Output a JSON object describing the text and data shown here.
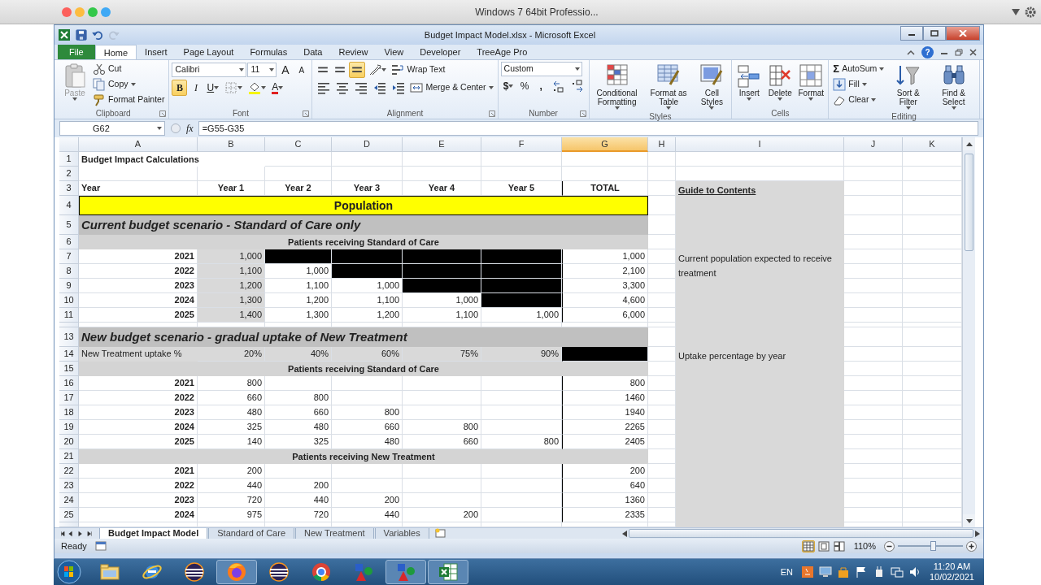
{
  "host": {
    "title": "Windows 7 64bit Professio..."
  },
  "excel": {
    "title": "Budget Impact Model.xlsx - Microsoft Excel",
    "quick_access": [
      {
        "kind": "save",
        "disabled": false
      },
      {
        "kind": "undo",
        "disabled": false
      },
      {
        "kind": "redo",
        "disabled": true
      }
    ],
    "tabs": [
      {
        "label": "File",
        "kind": "file",
        "selected": false
      },
      {
        "label": "Home",
        "kind": "tab",
        "selected": true
      },
      {
        "label": "Insert",
        "kind": "tab",
        "selected": false
      },
      {
        "label": "Page Layout",
        "kind": "tab",
        "selected": false
      },
      {
        "label": "Formulas",
        "kind": "tab",
        "selected": false
      },
      {
        "label": "Data",
        "kind": "tab",
        "selected": false
      },
      {
        "label": "Review",
        "kind": "tab",
        "selected": false
      },
      {
        "label": "View",
        "kind": "tab",
        "selected": false
      },
      {
        "label": "Developer",
        "kind": "tab",
        "selected": false
      },
      {
        "label": "TreeAge Pro",
        "kind": "tab",
        "selected": false
      }
    ],
    "help": "?",
    "groups": [
      {
        "label": "Clipboard",
        "launcher": true,
        "blocks": [
          {
            "kind": "large",
            "label": "Paste",
            "dropdown": true,
            "disabled": true
          },
          {
            "kind": "stack",
            "lines": [
              [
                {
                  "kind": "small",
                  "label": "Cut",
                  "dropdown": false
                }
              ],
              [
                {
                  "kind": "small",
                  "label": "Copy",
                  "dropdown": true
                }
              ],
              [
                {
                  "kind": "small",
                  "label": "Format Painter",
                  "dropdown": false
                }
              ]
            ]
          }
        ]
      },
      {
        "label": "Font",
        "launcher": true,
        "blocks": [
          {
            "kind": "stack",
            "lines": [
              [
                {
                  "kind": "combo",
                  "value": "Calibri"
                },
                {
                  "kind": "combo",
                  "value": "11"
                },
                {
                  "kind": "icon",
                  "text": "A",
                  "selected": false,
                  "dropdown": false
                },
                {
                  "kind": "icon",
                  "text": "A",
                  "selected": false,
                  "dropdown": false
                }
              ],
              [
                {
                  "kind": "icon",
                  "text": "B",
                  "selected": true,
                  "dropdown": false
                },
                {
                  "kind": "icon",
                  "text": "I",
                  "selected": false,
                  "dropdown": false
                },
                {
                  "kind": "icon",
                  "text": "U",
                  "selected": false,
                  "dropdown": true
                },
                {
                  "kind": "icon",
                  "selected": false,
                  "dropdown": true
                },
                {
                  "kind": "icon",
                  "selected": false,
                  "dropdown": true
                },
                {
                  "kind": "icon",
                  "text": "A",
                  "selected": false,
                  "dropdown": true
                }
              ]
            ]
          }
        ]
      },
      {
        "label": "Alignment",
        "launcher": true,
        "blocks": [
          {
            "kind": "stack",
            "lines": [
              [
                {
                  "kind": "icon",
                  "selected": false,
                  "dropdown": false
                },
                {
                  "kind": "icon",
                  "selected": false,
                  "dropdown": false
                },
                {
                  "kind": "icon",
                  "selected": true,
                  "dropdown": false
                },
                {
                  "kind": "icon",
                  "selected": false,
                  "dropdown": true
                },
                {
                  "kind": "small",
                  "label": "Wrap Text",
                  "dropdown": false
                }
              ],
              [
                {
                  "kind": "icon",
                  "selected": false,
                  "dropdown": false
                },
                {
                  "kind": "icon",
                  "selected": false,
                  "dropdown": false
                },
                {
                  "kind": "icon",
                  "selected": false,
                  "dropdown": false
                },
                {
                  "kind": "icon",
                  "selected": false,
                  "dropdown": false
                },
                {
                  "kind": "icon",
                  "selected": false,
                  "dropdown": false
                },
                {
                  "kind": "small",
                  "label": "Merge & Center",
                  "dropdown": true
                }
              ]
            ]
          }
        ]
      },
      {
        "label": "Number",
        "launcher": true,
        "blocks": [
          {
            "kind": "stack",
            "lines": [
              [
                {
                  "kind": "combo",
                  "value": "Custom"
                }
              ],
              [
                {
                  "kind": "icon",
                  "text": "$",
                  "selected": false,
                  "dropdown": true
                },
                {
                  "kind": "icon",
                  "text": "%",
                  "selected": false,
                  "dropdown": false
                },
                {
                  "kind": "icon",
                  "text": ",",
                  "selected": false,
                  "dropdown": false
                },
                {
                  "kind": "icon",
                  "selected": false,
                  "dropdown": false
                },
                {
                  "kind": "icon",
                  "selected": false,
                  "dropdown": false
                }
              ]
            ]
          }
        ]
      },
      {
        "label": "Styles",
        "launcher": false,
        "blocks": [
          {
            "kind": "large",
            "label": "Conditional Formatting",
            "dropdown": true,
            "disabled": false
          },
          {
            "kind": "large",
            "label": "Format as Table",
            "dropdown": true,
            "disabled": false
          },
          {
            "kind": "large",
            "label": "Cell Styles",
            "dropdown": true,
            "disabled": false
          }
        ]
      },
      {
        "label": "Cells",
        "launcher": false,
        "blocks": [
          {
            "kind": "large",
            "label": "Insert",
            "dropdown": true,
            "disabled": false
          },
          {
            "kind": "large",
            "label": "Delete",
            "dropdown": true,
            "disabled": false
          },
          {
            "kind": "large",
            "label": "Format",
            "dropdown": true,
            "disabled": false
          }
        ]
      },
      {
        "label": "Editing",
        "launcher": false,
        "blocks": [
          {
            "kind": "stack",
            "lines": [
              [
                {
                  "kind": "small",
                  "symbol": "Σ",
                  "label": "AutoSum",
                  "dropdown": true
                }
              ],
              [
                {
                  "kind": "small",
                  "label": "Fill",
                  "dropdown": true
                }
              ],
              [
                {
                  "kind": "small",
                  "label": "Clear",
                  "dropdown": true
                }
              ]
            ]
          },
          {
            "kind": "large",
            "label": "Sort & Filter",
            "dropdown": true,
            "disabled": false
          },
          {
            "kind": "large",
            "label": "Find & Select",
            "dropdown": true,
            "disabled": false
          }
        ]
      }
    ],
    "name_box": "G62",
    "function_label": "fx",
    "formula": "=G55-G35"
  },
  "sheet": {
    "columns": [
      {
        "label": "A",
        "selected": false
      },
      {
        "label": "B",
        "selected": false
      },
      {
        "label": "C",
        "selected": false
      },
      {
        "label": "D",
        "selected": false
      },
      {
        "label": "E",
        "selected": false
      },
      {
        "label": "F",
        "selected": false
      },
      {
        "label": "G",
        "selected": true
      },
      {
        "label": "H",
        "selected": false
      },
      {
        "label": "I",
        "selected": false
      },
      {
        "label": "J",
        "selected": false
      },
      {
        "label": "K",
        "selected": false
      }
    ],
    "rows": [
      {
        "n": "1",
        "kind": "title",
        "label": "Budget Impact Calculations"
      },
      {
        "n": "2",
        "kind": "blank"
      },
      {
        "n": "3",
        "kind": "header",
        "label": "Year",
        "values": [
          {
            "text": "Year 1"
          },
          {
            "text": "Year 2"
          },
          {
            "text": "Year 3"
          },
          {
            "text": "Year 4"
          },
          {
            "text": "Year 5"
          }
        ],
        "total": {
          "text": "TOTAL"
        },
        "note": "Guide to Contents"
      },
      {
        "n": "4",
        "kind": "population",
        "label": "Population"
      },
      {
        "n": "5",
        "kind": "scenario",
        "label": "Current budget scenario - Standard of Care only"
      },
      {
        "n": "6",
        "kind": "section",
        "label": "Patients receiving Standard of Care"
      },
      {
        "n": "7",
        "kind": "data",
        "label": "2021",
        "values": [
          {
            "text": "1,000",
            "color": "#d9d9d9"
          },
          {
            "color": "#000000"
          },
          {
            "color": "#000000"
          },
          {
            "color": "#000000"
          },
          {
            "color": "#000000"
          }
        ],
        "total": {
          "text": "1,000"
        },
        "note": "Current population expected to receive treatment"
      },
      {
        "n": "8",
        "kind": "data",
        "label": "2022",
        "values": [
          {
            "text": "1,100",
            "color": "#d9d9d9"
          },
          {
            "text": "1,000"
          },
          {
            "color": "#000000"
          },
          {
            "color": "#000000"
          },
          {
            "color": "#000000"
          }
        ],
        "total": {
          "text": "2,100"
        }
      },
      {
        "n": "9",
        "kind": "data",
        "label": "2023",
        "values": [
          {
            "text": "1,200",
            "color": "#d9d9d9"
          },
          {
            "text": "1,100"
          },
          {
            "text": "1,000"
          },
          {
            "color": "#000000"
          },
          {
            "color": "#000000"
          }
        ],
        "total": {
          "text": "3,300"
        }
      },
      {
        "n": "10",
        "kind": "data",
        "label": "2024",
        "values": [
          {
            "text": "1,300",
            "color": "#d9d9d9"
          },
          {
            "text": "1,200"
          },
          {
            "text": "1,100"
          },
          {
            "text": "1,000"
          },
          {
            "color": "#000000"
          }
        ],
        "total": {
          "text": "4,600"
        }
      },
      {
        "n": "11",
        "kind": "data",
        "label": "2025",
        "values": [
          {
            "text": "1,400",
            "color": "#d9d9d9"
          },
          {
            "text": "1,300"
          },
          {
            "text": "1,200"
          },
          {
            "text": "1,100"
          },
          {
            "text": "1,000"
          }
        ],
        "total": {
          "text": "6,000"
        }
      },
      {
        "kind": "gap"
      },
      {
        "n": "13",
        "kind": "scenario",
        "label": "New budget scenario - gradual uptake of New Treatment"
      },
      {
        "n": "14",
        "kind": "uptake",
        "label": "New Treatment uptake %",
        "values": [
          {
            "text": "20%",
            "color": "#d9d9d9"
          },
          {
            "text": "40%",
            "color": "#d9d9d9"
          },
          {
            "text": "60%",
            "color": "#d9d9d9"
          },
          {
            "text": "75%",
            "color": "#d9d9d9"
          },
          {
            "text": "90%",
            "color": "#d9d9d9"
          }
        ],
        "total": {
          "color": "#000000"
        },
        "note": "Uptake percentage by year"
      },
      {
        "n": "15",
        "kind": "section",
        "label": "Patients receiving Standard of Care"
      },
      {
        "n": "16",
        "kind": "data",
        "label": "2021",
        "values": [
          {
            "text": "800"
          }
        ],
        "total": {
          "text": "800"
        }
      },
      {
        "n": "17",
        "kind": "data",
        "label": "2022",
        "values": [
          {
            "text": "660"
          },
          {
            "text": "800"
          }
        ],
        "total": {
          "text": "1460"
        }
      },
      {
        "n": "18",
        "kind": "data",
        "label": "2023",
        "values": [
          {
            "text": "480"
          },
          {
            "text": "660"
          },
          {
            "text": "800"
          }
        ],
        "total": {
          "text": "1940"
        }
      },
      {
        "n": "19",
        "kind": "data",
        "label": "2024",
        "values": [
          {
            "text": "325"
          },
          {
            "text": "480"
          },
          {
            "text": "660"
          },
          {
            "text": "800"
          }
        ],
        "total": {
          "text": "2265"
        }
      },
      {
        "n": "20",
        "kind": "data",
        "label": "2025",
        "values": [
          {
            "text": "140"
          },
          {
            "text": "325"
          },
          {
            "text": "480"
          },
          {
            "text": "660"
          },
          {
            "text": "800"
          }
        ],
        "total": {
          "text": "2405"
        }
      },
      {
        "n": "21",
        "kind": "section",
        "label": "Patients receiving New Treatment"
      },
      {
        "n": "22",
        "kind": "data",
        "label": "2021",
        "values": [
          {
            "text": "200"
          }
        ],
        "total": {
          "text": "200"
        }
      },
      {
        "n": "23",
        "kind": "data",
        "label": "2022",
        "values": [
          {
            "text": "440"
          },
          {
            "text": "200"
          }
        ],
        "total": {
          "text": "640"
        }
      },
      {
        "n": "24",
        "kind": "data",
        "label": "2023",
        "values": [
          {
            "text": "720"
          },
          {
            "text": "440"
          },
          {
            "text": "200"
          }
        ],
        "total": {
          "text": "1360"
        }
      },
      {
        "n": "25",
        "kind": "data",
        "label": "2024",
        "values": [
          {
            "text": "975"
          },
          {
            "text": "720"
          },
          {
            "text": "440"
          },
          {
            "text": "200"
          }
        ],
        "total": {
          "text": "2335"
        }
      },
      {
        "kind": "gap"
      }
    ],
    "tabs": [
      {
        "label": "Budget Impact Model",
        "selected": true
      },
      {
        "label": "Standard of Care",
        "selected": false
      },
      {
        "label": "New Treatment",
        "selected": false
      },
      {
        "label": "Variables",
        "selected": false
      }
    ]
  },
  "status": {
    "text": "Ready",
    "views": [
      {
        "selected": true
      },
      {
        "selected": false
      },
      {
        "selected": false
      }
    ],
    "zoom": "110%",
    "zoom_slider": {
      "level": 0.54
    }
  },
  "taskbar": {
    "apps": [
      {
        "kind": "explorer",
        "open": false
      },
      {
        "kind": "ie",
        "open": false
      },
      {
        "kind": "eclipse",
        "open": false
      },
      {
        "kind": "firefox",
        "open": true
      },
      {
        "kind": "eclipse",
        "open": false
      },
      {
        "kind": "chrome",
        "open": false
      },
      {
        "kind": "shapes",
        "open": false
      },
      {
        "kind": "shapes",
        "open": true
      },
      {
        "kind": "excel",
        "open": true
      }
    ],
    "language": "EN",
    "time": "11:20 AM",
    "date": "10/02/2021"
  }
}
